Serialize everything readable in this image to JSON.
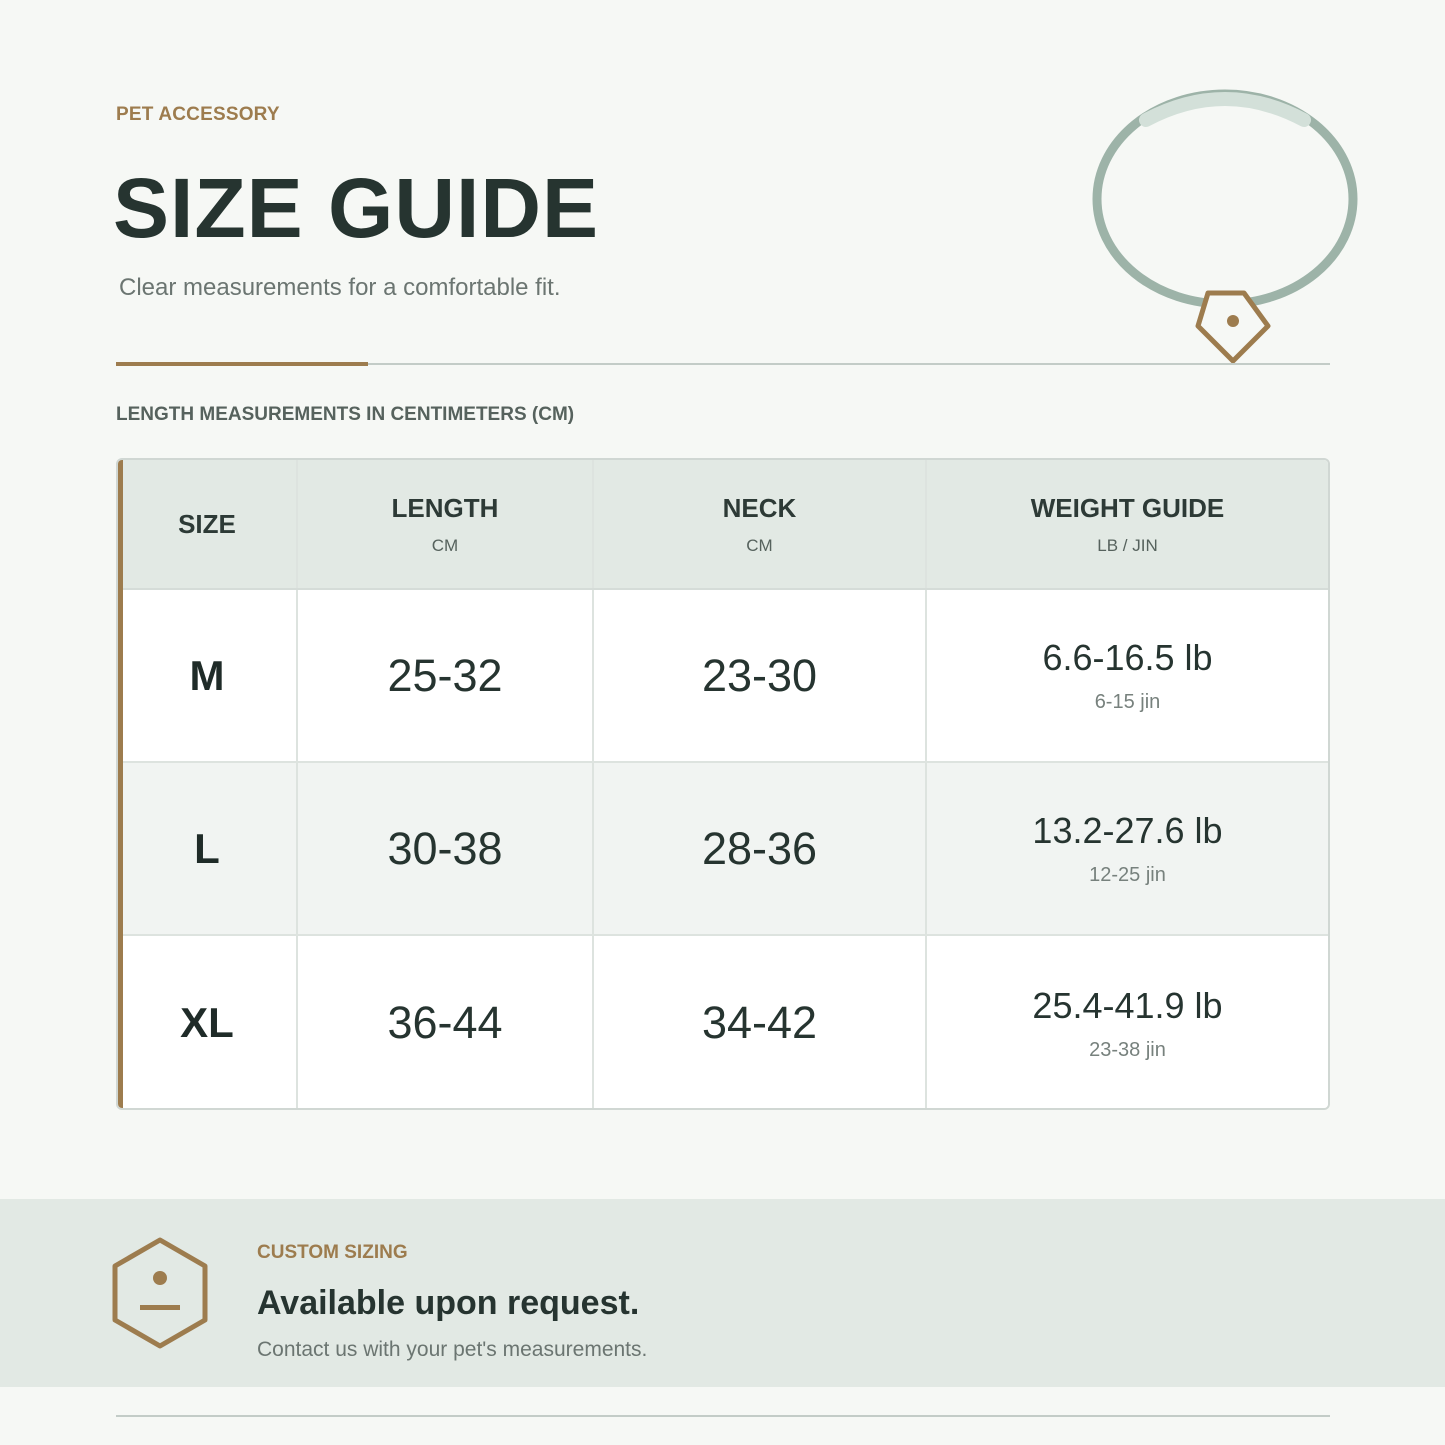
{
  "header": {
    "eyebrow": "PET ACCESSORY",
    "title": "SIZE GUIDE",
    "subtitle": "Clear measurements for a comfortable fit."
  },
  "illustration": {
    "icon": "collar-with-tag-icon"
  },
  "table": {
    "caption": "LENGTH MEASUREMENTS IN CENTIMETERS (CM)",
    "columns": [
      {
        "label": "SIZE",
        "unit": ""
      },
      {
        "label": "LENGTH",
        "unit": "CM"
      },
      {
        "label": "NECK",
        "unit": "CM"
      },
      {
        "label": "WEIGHT GUIDE",
        "unit": "LB / JIN"
      }
    ],
    "rows": [
      {
        "size": "M",
        "length": "25-32",
        "neck": "23-30",
        "weight_lb": "6.6-16.5 lb",
        "weight_jin": "6-15 jin"
      },
      {
        "size": "L",
        "length": "30-38",
        "neck": "28-36",
        "weight_lb": "13.2-27.6 lb",
        "weight_jin": "12-25 jin"
      },
      {
        "size": "XL",
        "length": "36-44",
        "neck": "34-42",
        "weight_lb": "25.4-41.9 lb",
        "weight_jin": "23-38 jin"
      }
    ]
  },
  "custom": {
    "icon": "hexagon-badge-icon",
    "eyebrow": "CUSTOM SIZING",
    "headline": "Available upon request.",
    "text": "Contact us with your pet's measurements."
  },
  "colors": {
    "accent": "#9d7c4e",
    "text": "#263430",
    "muted": "#6b7571",
    "sage": "#9db3a8",
    "header_bg": "#e2e9e4",
    "page_bg": "#f6f8f5"
  }
}
